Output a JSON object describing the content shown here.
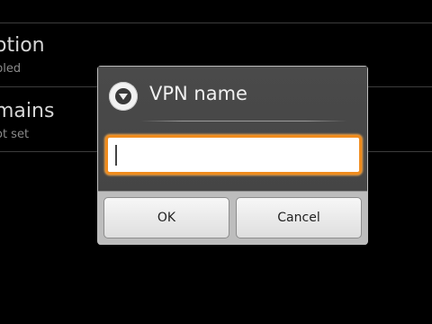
{
  "background_list": {
    "items": [
      {
        "title": "otion",
        "summary": "bled"
      },
      {
        "title": "mains",
        "summary": "ot set"
      }
    ]
  },
  "dialog": {
    "icon": "dropdown-arrow-icon",
    "title": "VPN name",
    "input": {
      "value": "",
      "placeholder": ""
    },
    "buttons": {
      "ok": "OK",
      "cancel": "Cancel"
    }
  },
  "colors": {
    "background": "#000000",
    "dialog_body": "#474747",
    "button_bar": "#bdbdbd",
    "focus_ring": "#f08c1e"
  }
}
